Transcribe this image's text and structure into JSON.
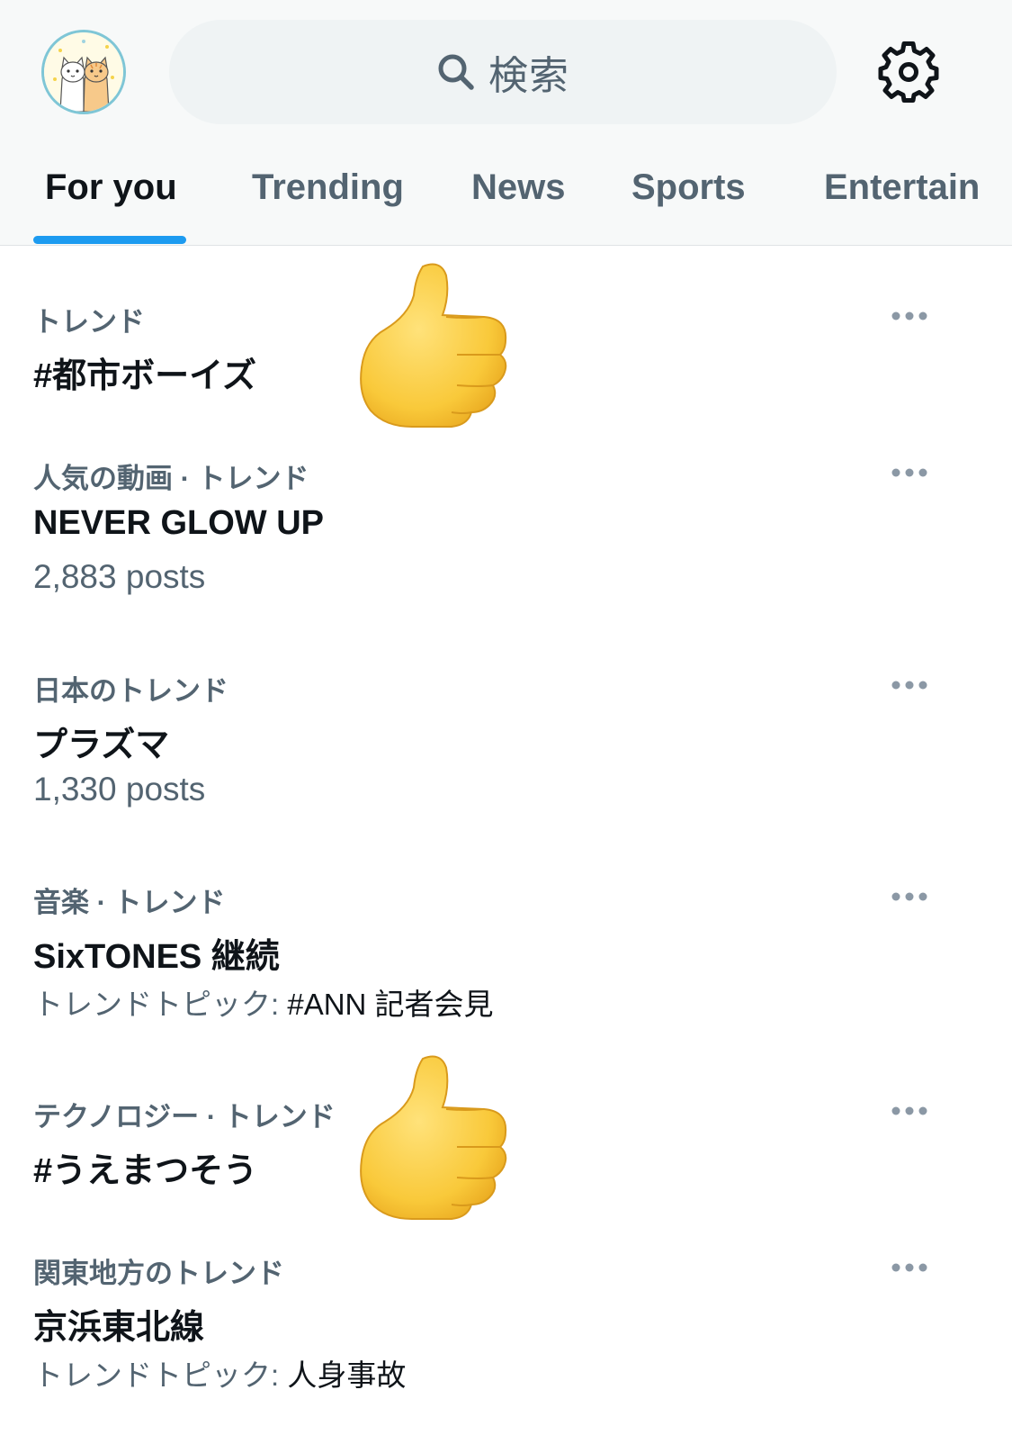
{
  "search": {
    "placeholder": "検索"
  },
  "tabs": [
    {
      "label": "For you",
      "active": true
    },
    {
      "label": "Trending",
      "active": false
    },
    {
      "label": "News",
      "active": false
    },
    {
      "label": "Sports",
      "active": false
    },
    {
      "label": "Entertain",
      "active": false
    }
  ],
  "colors": {
    "accent": "#1d9bf0",
    "primary_text": "#0f1419",
    "secondary_text": "#536471",
    "search_bg": "#eff3f4"
  },
  "icons": {
    "search": "search-icon",
    "settings": "gear-icon",
    "more": "more-options-icon",
    "thumbs_up": "thumbs-up-emoji"
  },
  "trends": [
    {
      "meta": "トレンド",
      "title": "#都市ボーイズ",
      "sub": "",
      "topic": ""
    },
    {
      "meta": "人気の動画 · トレンド",
      "title": "NEVER GLOW UP",
      "sub": "2,883 posts",
      "topic": ""
    },
    {
      "meta": "日本のトレンド",
      "title": "プラズマ",
      "sub": "1,330 posts",
      "topic": ""
    },
    {
      "meta": "音楽 · トレンド",
      "title": "SixTONES 継続",
      "sub": "トレンドトピック: ",
      "topic": "#ANN 記者会見"
    },
    {
      "meta": "テクノロジー · トレンド",
      "title": "#うえまつそう",
      "sub": "",
      "topic": ""
    },
    {
      "meta": "関東地方のトレンド",
      "title": "京浜東北線",
      "sub": "トレンドトピック: ",
      "topic": "人身事故"
    }
  ]
}
